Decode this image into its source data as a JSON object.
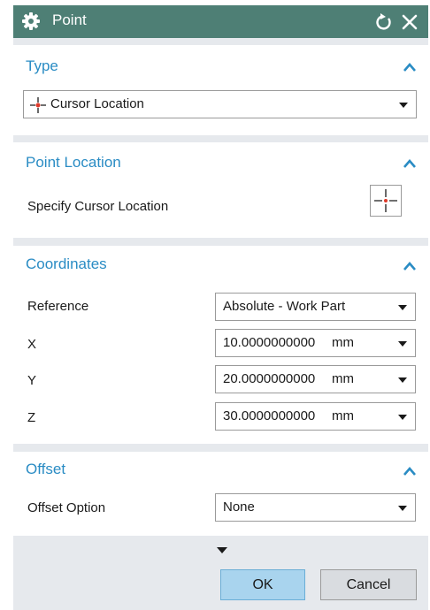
{
  "dialog": {
    "title": "Point",
    "icons": {
      "app": "gear-icon",
      "reset": "reset-icon",
      "close": "close-icon"
    },
    "colors": {
      "titlebar": "#4e7f75",
      "section_title": "#2a8cc4",
      "ok_button": "#a9d4ee",
      "background": "#e6e9ed"
    }
  },
  "type_section": {
    "title": "Type",
    "selected_type": "Cursor Location",
    "type_icon": "cursor-location-icon"
  },
  "point_location": {
    "title": "Point Location",
    "specify_label": "Specify Cursor Location",
    "picker_icon": "crosshair-icon"
  },
  "coordinates": {
    "title": "Coordinates",
    "reference_label": "Reference",
    "reference_value": "Absolute - Work Part",
    "x_label": "X",
    "x_value": "10.0000000000",
    "x_unit": "mm",
    "y_label": "Y",
    "y_value": "20.0000000000",
    "y_unit": "mm",
    "z_label": "Z",
    "z_value": "30.0000000000",
    "z_unit": "mm"
  },
  "offset": {
    "title": "Offset",
    "option_label": "Offset Option",
    "option_value": "None"
  },
  "footer": {
    "ok_label": "OK",
    "cancel_label": "Cancel"
  }
}
